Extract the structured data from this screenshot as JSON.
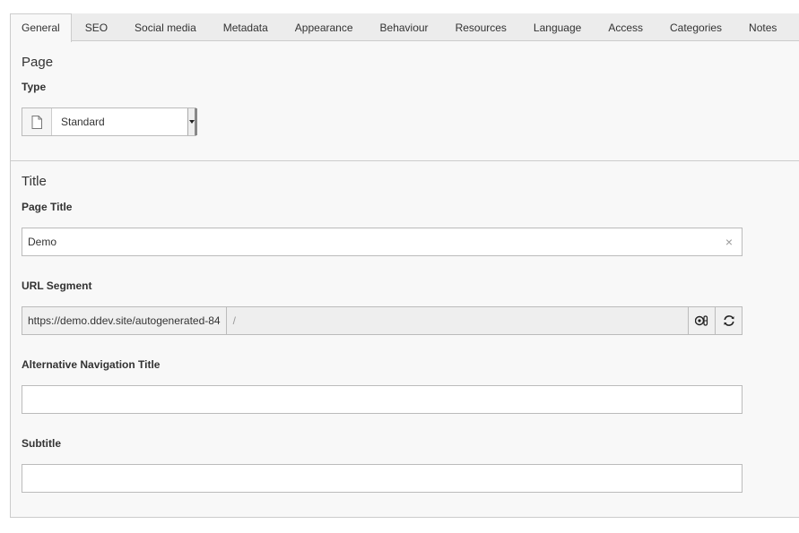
{
  "tabs": [
    "General",
    "SEO",
    "Social media",
    "Metadata",
    "Appearance",
    "Behaviour",
    "Resources",
    "Language",
    "Access",
    "Categories",
    "Notes"
  ],
  "page_section": {
    "heading": "Page",
    "type_label": "Type",
    "type_value": "Standard"
  },
  "title_section": {
    "heading": "Title",
    "page_title_label": "Page Title",
    "page_title_value": "Demo",
    "clear_symbol": "×",
    "url_label": "URL Segment",
    "url_prefix": "https://demo.ddev.site/autogenerated-84",
    "url_value": "/",
    "alt_nav_label": "Alternative Navigation Title",
    "alt_nav_value": "",
    "subtitle_label": "Subtitle",
    "subtitle_value": ""
  },
  "icons": {
    "page_type": "document-icon",
    "toggle_edit": "toggle-edit-icon",
    "recreate": "refresh-icon"
  }
}
